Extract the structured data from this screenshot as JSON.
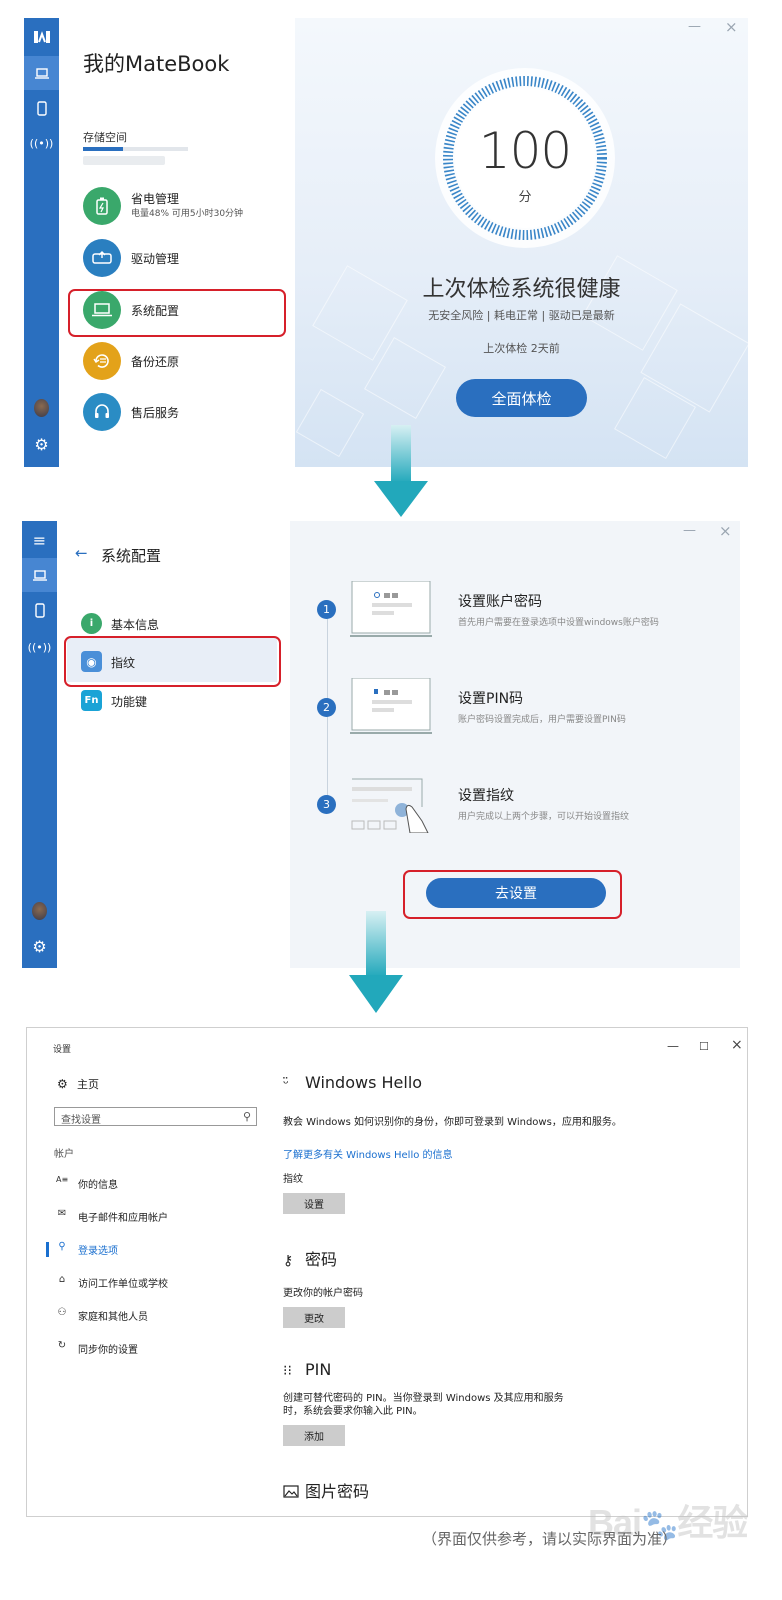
{
  "panel1": {
    "app_title": "我的MateBook",
    "storage_label": "存储空间",
    "storage_fraction": 0.38,
    "menu": [
      {
        "label": "省电管理",
        "sub": "电量48% 可用5小时30分钟",
        "icon": "battery-icon",
        "color": "#3aa86b"
      },
      {
        "label": "驱动管理",
        "sub": "",
        "icon": "driver-icon",
        "color": "#2a7fc0"
      },
      {
        "label": "系统配置",
        "sub": "",
        "icon": "laptop-icon",
        "color": "#3aa86b"
      },
      {
        "label": "备份还原",
        "sub": "",
        "icon": "backup-icon",
        "color": "#e3a21a"
      },
      {
        "label": "售后服务",
        "sub": "",
        "icon": "headset-icon",
        "color": "#2a8cc4"
      }
    ],
    "score": "100",
    "score_unit": "分",
    "health_title": "上次体检系统很健康",
    "health_sub": "无安全风险 |  耗电正常  |  驱动已是最新",
    "last_check": "上次体检 2天前",
    "check_button": "全面体检",
    "window_min": "—",
    "window_close": "×"
  },
  "panel2": {
    "back_glyph": "←",
    "title": "系统配置",
    "items": [
      {
        "label": "基本信息",
        "icon": "info-icon",
        "glyph": "i",
        "color": "#3aa86b"
      },
      {
        "label": "指纹",
        "icon": "fingerprint-icon",
        "glyph": "◉",
        "color": "#4a8fd8"
      },
      {
        "label": "功能键",
        "icon": "fn-key-icon",
        "glyph": "Fn",
        "color": "#1aa3d6"
      }
    ],
    "steps": [
      {
        "num": "1",
        "title": "设置账户密码",
        "desc": "首先用户需要在登录选项中设置windows账户密码"
      },
      {
        "num": "2",
        "title": "设置PIN码",
        "desc": "账户密码设置完成后，用户需要设置PIN码"
      },
      {
        "num": "3",
        "title": "设置指纹",
        "desc": "用户完成以上两个步骤，可以开始设置指纹"
      }
    ],
    "go_button": "去设置",
    "window_min": "—",
    "window_close": "×"
  },
  "panel3": {
    "caption": "设置",
    "window_min": "—",
    "window_max": "☐",
    "window_close": "×",
    "home": "主页",
    "search_placeholder": "查找设置",
    "section": "帐户",
    "nav": [
      {
        "label": "你的信息",
        "icon": "person-info-icon",
        "glyph": "A≡"
      },
      {
        "label": "电子邮件和应用帐户",
        "icon": "mail-icon",
        "glyph": "✉"
      },
      {
        "label": "登录选项",
        "icon": "key-icon",
        "glyph": "⚲"
      },
      {
        "label": "访问工作单位或学校",
        "icon": "briefcase-icon",
        "glyph": "⌂"
      },
      {
        "label": "家庭和其他人员",
        "icon": "person-add-icon",
        "glyph": "⚇"
      },
      {
        "label": "同步你的设置",
        "icon": "sync-icon",
        "glyph": "↻"
      }
    ],
    "hello_title": "Windows Hello",
    "hello_desc": "教会 Windows 如何识别你的身份，你即可登录到 Windows，应用和服务。",
    "hello_link": "了解更多有关 Windows Hello 的信息",
    "fingerprint_label": "指纹",
    "fingerprint_button": "设置",
    "password_title": "密码",
    "password_desc": "更改你的帐户密码",
    "password_button": "更改",
    "pin_title": "PIN",
    "pin_desc_1": "创建可替代密码的 PIN。当你登录到 Windows 及其应用和服务",
    "pin_desc_2": "时，系统会要求你输入此 PIN。",
    "pin_button": "添加",
    "picture_title": "图片密码"
  },
  "footer_note": "（界面仅供参考，请以实际界面为准）"
}
